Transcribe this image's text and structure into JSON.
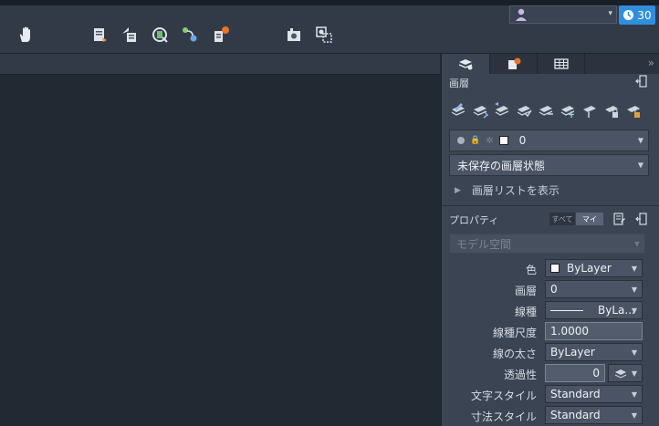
{
  "toolbar": {
    "icons": [
      "pan-icon",
      "layer-states-icon",
      "layer-iso-icon",
      "layer-match-icon",
      "layer-walk-icon",
      "layer-freeze-icon",
      "view-camera-icon",
      "zoom-extents-icon"
    ]
  },
  "header": {
    "user_dropdown_arrow": "▾",
    "timer_value": "30"
  },
  "panel": {
    "collapse_glyph": "»",
    "tabs": [
      "layers-tab",
      "markup-tab",
      "table-tab"
    ],
    "layers": {
      "title": "画層",
      "current_layer": "0",
      "layer_state": "未保存の画層状態",
      "show_list_label": "画層リストを表示"
    },
    "properties": {
      "title": "プロパティ",
      "toggle_all": "すべて",
      "toggle_mine": "マイ",
      "space": "モデル空間",
      "rows": [
        {
          "label": "色",
          "value": "ByLayer"
        },
        {
          "label": "画層",
          "value": "0"
        },
        {
          "label": "線種",
          "value": "ByLa..."
        },
        {
          "label": "線種尺度",
          "value": "1.0000"
        },
        {
          "label": "線の太さ",
          "value": "ByLayer"
        },
        {
          "label": "透過性",
          "value": "0"
        },
        {
          "label": "文字スタイル",
          "value": "Standard"
        },
        {
          "label": "寸法スタイル",
          "value": "Standard"
        }
      ]
    }
  },
  "colors": {
    "accent": "#2f8fdd",
    "panel": "#3b4453",
    "canvas": "#232933",
    "badge": "#e8742a"
  }
}
